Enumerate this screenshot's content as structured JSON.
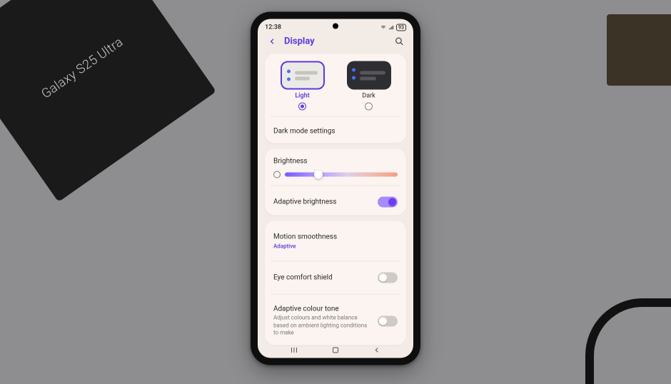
{
  "prop": {
    "boxLabel": "Galaxy S25 Ultra"
  },
  "status": {
    "time": "12:38",
    "battery": "93"
  },
  "header": {
    "title": "Display"
  },
  "theme": {
    "light": "Light",
    "dark": "Dark",
    "selected": "light",
    "darkModeSettings": "Dark mode settings"
  },
  "brightness": {
    "title": "Brightness",
    "position": 30,
    "adaptive": {
      "label": "Adaptive brightness",
      "on": true
    }
  },
  "motion": {
    "title": "Motion smoothness",
    "value": "Adaptive"
  },
  "eyeComfort": {
    "label": "Eye comfort shield",
    "on": false
  },
  "colourTone": {
    "title": "Adaptive colour tone",
    "desc": "Adjust colours and white balance based on ambient lighting conditions to make",
    "on": false
  }
}
